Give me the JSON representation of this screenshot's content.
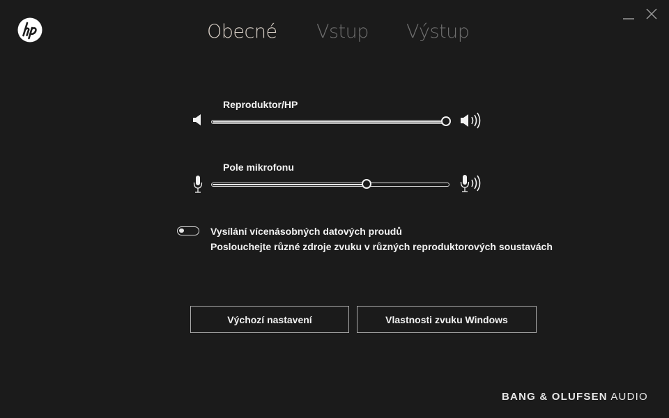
{
  "tabs": [
    {
      "label": "Obecné",
      "active": true
    },
    {
      "label": "Vstup",
      "active": false
    },
    {
      "label": "Výstup",
      "active": false
    }
  ],
  "speaker": {
    "label": "Reproduktor/HP",
    "value_percent": 100
  },
  "mic": {
    "label": "Pole mikrofonu",
    "value_percent": 66
  },
  "multistream": {
    "title": "Vysílání vícenásobných datových proudů",
    "description": "Poslouchejte různé zdroje zvuku v různých reproduktorových soustavách",
    "enabled": false
  },
  "buttons": {
    "defaults_label": "Výchozí nastavení",
    "windows_sound_label": "Vlastnosti zvuku Windows"
  },
  "brand": {
    "main": "BANG & OLUFSEN",
    "suffix": " AUDIO"
  },
  "icons": {
    "logo": "hp-logo",
    "minimize": "minimize-icon",
    "close": "close-icon",
    "speaker_low": "speaker-low-icon",
    "speaker_high": "speaker-high-icon",
    "mic_low": "microphone-low-icon",
    "mic_high": "microphone-high-icon"
  },
  "colors": {
    "background": "#1b1b1b",
    "active_tab": "#d8cfc6",
    "inactive_tab": "#6f6f6f"
  }
}
